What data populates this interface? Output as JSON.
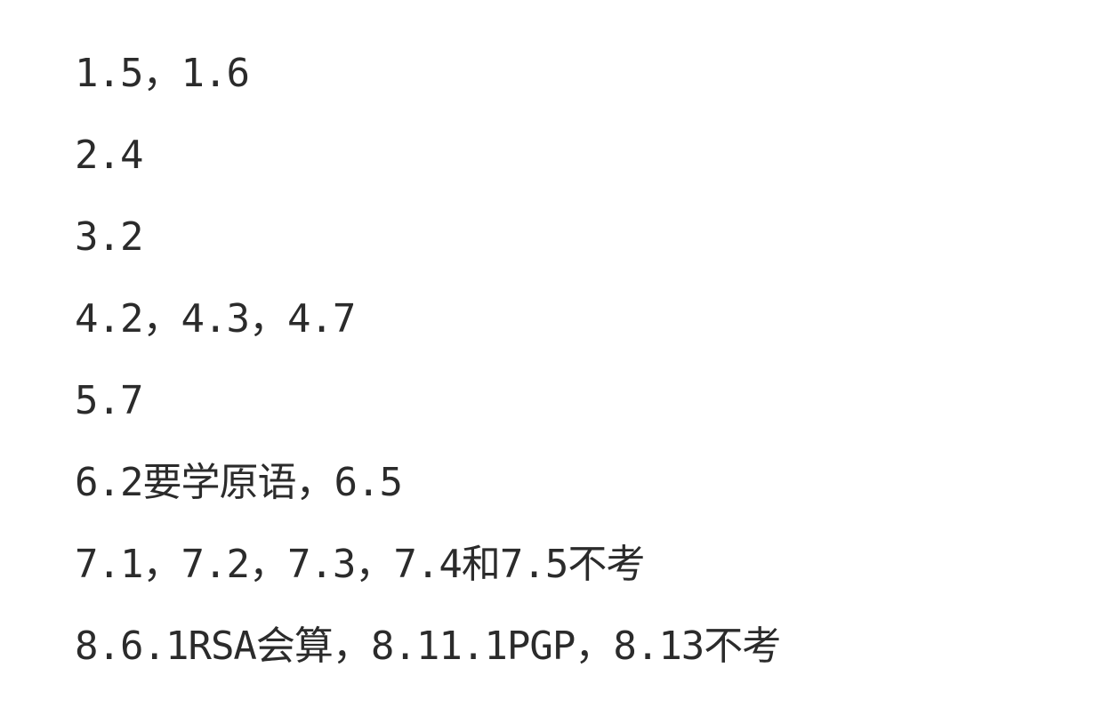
{
  "document": {
    "lines": [
      "1.5，1.6",
      "2.4",
      "3.2",
      "4.2，4.3，4.7",
      "5.7",
      "6.2要学原语，6.5",
      "7.1，7.2，7.3，7.4和7.5不考",
      "8.6.1RSA会算，8.11.1PGP，8.13不考"
    ]
  }
}
